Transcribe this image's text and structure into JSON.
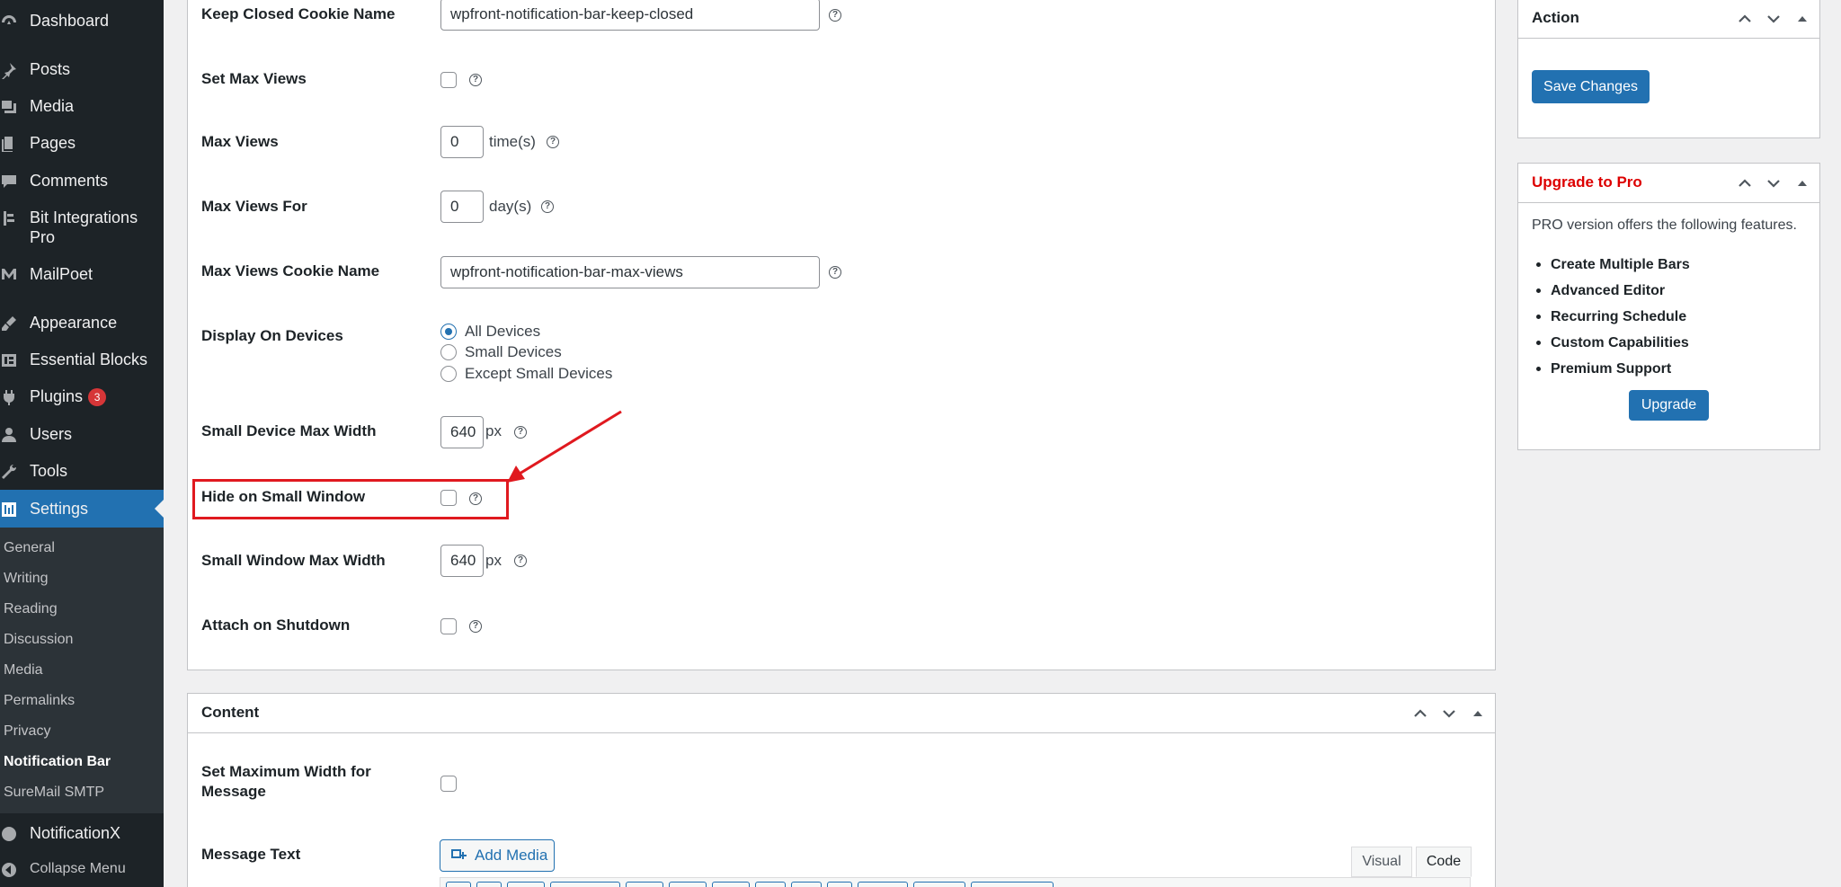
{
  "sidebar": {
    "items": [
      {
        "label": "Dashboard",
        "icon": "dashboard-icon"
      },
      {
        "label": "Posts",
        "icon": "pin-icon"
      },
      {
        "label": "Media",
        "icon": "media-icon"
      },
      {
        "label": "Pages",
        "icon": "pages-icon"
      },
      {
        "label": "Comments",
        "icon": "comment-icon"
      },
      {
        "label": "Bit Integrations Pro",
        "icon": "bit-icon"
      },
      {
        "label": "MailPoet",
        "icon": "mailpoet-icon"
      },
      {
        "label": "Appearance",
        "icon": "brush-icon"
      },
      {
        "label": "Essential Blocks",
        "icon": "blocks-icon"
      },
      {
        "label": "Plugins",
        "icon": "plugin-icon",
        "badge": "3"
      },
      {
        "label": "Users",
        "icon": "user-icon"
      },
      {
        "label": "Tools",
        "icon": "wrench-icon"
      },
      {
        "label": "Settings",
        "icon": "settings-icon"
      }
    ],
    "submenu": [
      "General",
      "Writing",
      "Reading",
      "Discussion",
      "Media",
      "Permalinks",
      "Privacy",
      "Notification Bar",
      "SureMail SMTP"
    ],
    "bottom": [
      {
        "label": "NotificationX",
        "icon": "notificationx-icon"
      },
      {
        "label": "Collapse Menu",
        "icon": "collapse-icon"
      }
    ]
  },
  "settings": {
    "keep_closed_cookie": {
      "label": "Keep Closed Cookie Name",
      "value": "wpfront-notification-bar-keep-closed"
    },
    "set_max_views": {
      "label": "Set Max Views"
    },
    "max_views": {
      "label": "Max Views",
      "value": "0",
      "unit": "time(s)"
    },
    "max_views_for": {
      "label": "Max Views For",
      "value": "0",
      "unit": "day(s)"
    },
    "max_views_cookie": {
      "label": "Max Views Cookie Name",
      "value": "wpfront-notification-bar-max-views"
    },
    "display_on_devices": {
      "label": "Display On Devices",
      "options": [
        "All Devices",
        "Small Devices",
        "Except Small Devices"
      ],
      "selected": "All Devices"
    },
    "small_device_max_width": {
      "label": "Small Device Max Width",
      "value": "640",
      "unit": "px"
    },
    "hide_small_window": {
      "label": "Hide on Small Window"
    },
    "small_window_max_width": {
      "label": "Small Window Max Width",
      "value": "640",
      "unit": "px"
    },
    "attach_shutdown": {
      "label": "Attach on Shutdown"
    },
    "help_glyph": "?"
  },
  "content": {
    "title": "Content",
    "set_max_width": {
      "label": "Set Maximum Width for Message"
    },
    "message_text": {
      "label": "Message Text"
    },
    "add_media": "Add Media",
    "tabs": {
      "visual": "Visual",
      "code": "Code"
    }
  },
  "action": {
    "title": "Action",
    "save": "Save Changes"
  },
  "upgrade": {
    "title": "Upgrade to Pro",
    "text": "PRO version offers the following features.",
    "features": [
      "Create Multiple Bars",
      "Advanced Editor",
      "Recurring Schedule",
      "Custom Capabilities",
      "Premium Support"
    ],
    "button": "Upgrade"
  },
  "colors": {
    "sidebar_bg": "#1d2327",
    "accent": "#2271b1",
    "annotation": "#e0191f",
    "upgrade_title": "#dd0000"
  }
}
